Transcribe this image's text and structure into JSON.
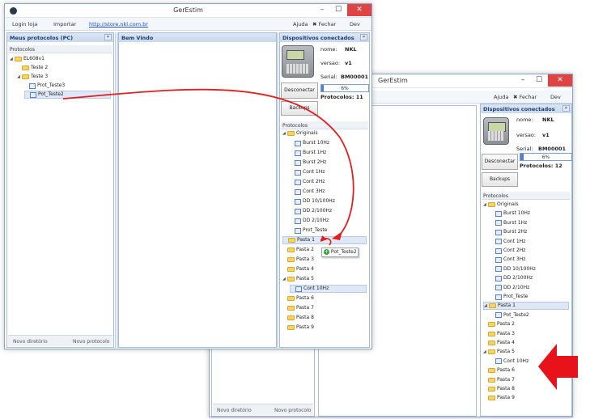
{
  "window1": {
    "title": "GerEstim",
    "menu": {
      "login": "Login loja",
      "import": "Importar",
      "link": "http://store.nkl.com.br",
      "help": "Ajuda",
      "close": "Fechar",
      "dev": "Dev"
    },
    "left_panel": {
      "title": "Meus protocolos (PC)",
      "collapse": "«",
      "header": "Protocolos",
      "tree": [
        {
          "label": "EL608v1",
          "icon": "folder-icon",
          "level": 0,
          "expanded": true
        },
        {
          "label": "Teste 2",
          "icon": "folder-icon",
          "level": 1
        },
        {
          "label": "Teste 3",
          "icon": "folder-icon",
          "level": 1,
          "expanded": true
        },
        {
          "label": "Prot_Teste3",
          "icon": "protocol-icon",
          "level": 2
        },
        {
          "label": "Pot_Teste2",
          "icon": "protocol-icon",
          "level": 2,
          "selected": true
        }
      ],
      "footer": {
        "new_dir": "Novo diretório",
        "new_proto": "Novo protocolo"
      }
    },
    "center_panel": {
      "title": "Bem Vindo"
    },
    "right_panel": {
      "title": "Dispositivos conectados",
      "expand": "»",
      "name_label": "nome:",
      "name_value": "NKL",
      "version_label": "versao:",
      "version_value": "v1",
      "serial_label": "Serial:",
      "serial_value": "BM00001",
      "disconnect": "Desconectar",
      "progress": "6%",
      "progress_value": 6,
      "protocols_count": "Protocolos: 11",
      "backup": "Backups",
      "header": "Protocolos",
      "tree": [
        {
          "label": "Originais",
          "icon": "folder-icon",
          "level": 0,
          "expanded": true
        },
        {
          "label": "Burst 10Hz",
          "icon": "protocol-icon",
          "level": 1
        },
        {
          "label": "Burst 1Hz",
          "icon": "protocol-icon",
          "level": 1
        },
        {
          "label": "Burst 2Hz",
          "icon": "protocol-icon",
          "level": 1
        },
        {
          "label": "Cont 1Hz",
          "icon": "protocol-icon",
          "level": 1
        },
        {
          "label": "Cont 2Hz",
          "icon": "protocol-icon",
          "level": 1
        },
        {
          "label": "Cont 3Hz",
          "icon": "protocol-icon",
          "level": 1
        },
        {
          "label": "DD 10/100Hz",
          "icon": "protocol-icon",
          "level": 1
        },
        {
          "label": "DD 2/100Hz",
          "icon": "protocol-icon",
          "level": 1
        },
        {
          "label": "DD 2/10Hz",
          "icon": "protocol-icon",
          "level": 1
        },
        {
          "label": "Prot_Teste",
          "icon": "protocol-icon",
          "level": 1
        },
        {
          "label": "Pasta 1",
          "icon": "folder-icon",
          "level": 0,
          "selected": true
        },
        {
          "label": "Pasta 2",
          "icon": "folder-icon",
          "level": 0
        },
        {
          "label": "Pasta 3",
          "icon": "folder-icon",
          "level": 0
        },
        {
          "label": "Pasta 4",
          "icon": "folder-icon",
          "level": 0
        },
        {
          "label": "Pasta 5",
          "icon": "folder-icon",
          "level": 0,
          "expanded": true
        },
        {
          "label": "Cont 10Hz",
          "icon": "protocol-icon",
          "level": 1,
          "selected": true
        },
        {
          "label": "Pasta 6",
          "icon": "folder-icon",
          "level": 0
        },
        {
          "label": "Pasta 7",
          "icon": "folder-icon",
          "level": 0
        },
        {
          "label": "Pasta 8",
          "icon": "folder-icon",
          "level": 0
        },
        {
          "label": "Pasta 9",
          "icon": "folder-icon",
          "level": 0
        }
      ],
      "drag_label": "Pot_Teste2"
    }
  },
  "window2": {
    "title": "GerEstim",
    "menu": {
      "help": "Ajuda",
      "close": "Fechar",
      "dev": "Dev"
    },
    "left_footer": {
      "new_dir": "Novo diretório",
      "new_proto": "Novo protocolo"
    },
    "right_panel": {
      "title": "Dispositivos conectados",
      "expand": "»",
      "name_label": "nome:",
      "name_value": "NKL",
      "version_label": "versao:",
      "version_value": "v1",
      "serial_label": "Serial:",
      "serial_value": "BM00001",
      "disconnect": "Desconectar",
      "progress": "6%",
      "progress_value": 6,
      "protocols_count": "Protocolos: 12",
      "backup": "Backups",
      "header": "Protocolos",
      "tree": [
        {
          "label": "Originais",
          "icon": "folder-icon",
          "level": 0,
          "expanded": true
        },
        {
          "label": "Burst 10Hz",
          "icon": "protocol-icon",
          "level": 1
        },
        {
          "label": "Burst 1Hz",
          "icon": "protocol-icon",
          "level": 1
        },
        {
          "label": "Burst 2Hz",
          "icon": "protocol-icon",
          "level": 1
        },
        {
          "label": "Cont 1Hz",
          "icon": "protocol-icon",
          "level": 1
        },
        {
          "label": "Cont 2Hz",
          "icon": "protocol-icon",
          "level": 1
        },
        {
          "label": "Cont 3Hz",
          "icon": "protocol-icon",
          "level": 1
        },
        {
          "label": "DD 10/100Hz",
          "icon": "protocol-icon",
          "level": 1
        },
        {
          "label": "DD 2/100Hz",
          "icon": "protocol-icon",
          "level": 1
        },
        {
          "label": "DD 2/10Hz",
          "icon": "protocol-icon",
          "level": 1
        },
        {
          "label": "Prot_Teste",
          "icon": "protocol-icon",
          "level": 1
        },
        {
          "label": "Pasta 1",
          "icon": "folder-icon",
          "level": 0,
          "expanded": true,
          "selected": true
        },
        {
          "label": "Pot_Teste2",
          "icon": "protocol-icon",
          "level": 1
        },
        {
          "label": "Pasta 2",
          "icon": "folder-icon",
          "level": 0
        },
        {
          "label": "Pasta 3",
          "icon": "folder-icon",
          "level": 0
        },
        {
          "label": "Pasta 4",
          "icon": "folder-icon",
          "level": 0
        },
        {
          "label": "Pasta 5",
          "icon": "folder-icon",
          "level": 0,
          "expanded": true
        },
        {
          "label": "Cont 10Hz",
          "icon": "protocol-icon",
          "level": 1
        },
        {
          "label": "Pasta 6",
          "icon": "folder-icon",
          "level": 0
        },
        {
          "label": "Pasta 7",
          "icon": "folder-icon",
          "level": 0
        },
        {
          "label": "Pasta 8",
          "icon": "folder-icon",
          "level": 0
        },
        {
          "label": "Pasta 9",
          "icon": "folder-icon",
          "level": 0
        }
      ]
    }
  },
  "colors": {
    "accent": "#1b3d6e",
    "drag_arrow": "#e02020",
    "callout_arrow": "#e8121b",
    "close_button": "#e04343"
  }
}
